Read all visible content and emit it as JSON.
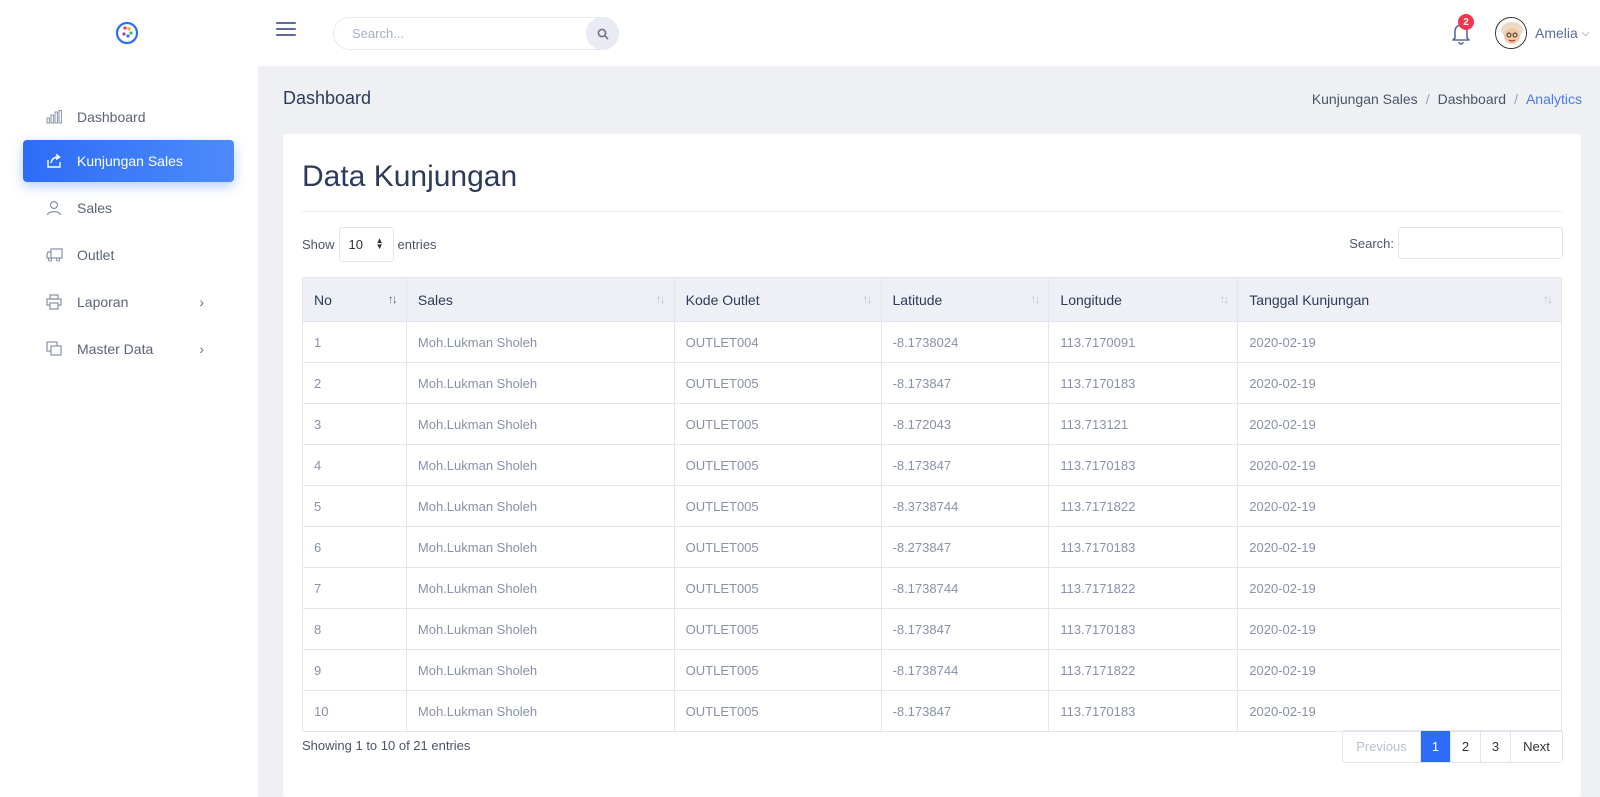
{
  "topbar": {
    "search_placeholder": "Search...",
    "notification_count": "2",
    "user_name": "Amelia"
  },
  "sidebar": {
    "items": [
      {
        "label": "Dashboard",
        "icon": "bar-chart-icon",
        "active": false,
        "has_submenu": false
      },
      {
        "label": "Kunjungan Sales",
        "icon": "share-icon",
        "active": true,
        "has_submenu": false
      },
      {
        "label": "Sales",
        "icon": "user-icon",
        "active": false,
        "has_submenu": false
      },
      {
        "label": "Outlet",
        "icon": "truck-icon",
        "active": false,
        "has_submenu": false
      },
      {
        "label": "Laporan",
        "icon": "printer-icon",
        "active": false,
        "has_submenu": true
      },
      {
        "label": "Master Data",
        "icon": "copy-icon",
        "active": false,
        "has_submenu": true
      }
    ]
  },
  "header": {
    "title": "Dashboard",
    "breadcrumb": [
      "Kunjungan Sales",
      "Dashboard",
      "Analytics"
    ]
  },
  "card": {
    "title": "Data Kunjungan",
    "show_label": "Show",
    "page_length": "10",
    "entries_label": "entries",
    "search_label": "Search:",
    "columns": [
      "No",
      "Sales",
      "Kode Outlet",
      "Latitude",
      "Longitude",
      "Tanggal Kunjungan"
    ],
    "rows": [
      [
        "1",
        "Moh.Lukman Sholeh",
        "OUTLET004",
        "-8.1738024",
        "113.7170091",
        "2020-02-19"
      ],
      [
        "2",
        "Moh.Lukman Sholeh",
        "OUTLET005",
        "-8.173847",
        "113.7170183",
        "2020-02-19"
      ],
      [
        "3",
        "Moh.Lukman Sholeh",
        "OUTLET005",
        "-8.172043",
        "113.713121",
        "2020-02-19"
      ],
      [
        "4",
        "Moh.Lukman Sholeh",
        "OUTLET005",
        "-8.173847",
        "113.7170183",
        "2020-02-19"
      ],
      [
        "5",
        "Moh.Lukman Sholeh",
        "OUTLET005",
        "-8.3738744",
        "113.7171822",
        "2020-02-19"
      ],
      [
        "6",
        "Moh.Lukman Sholeh",
        "OUTLET005",
        "-8.273847",
        "113.7170183",
        "2020-02-19"
      ],
      [
        "7",
        "Moh.Lukman Sholeh",
        "OUTLET005",
        "-8.1738744",
        "113.7171822",
        "2020-02-19"
      ],
      [
        "8",
        "Moh.Lukman Sholeh",
        "OUTLET005",
        "-8.173847",
        "113.7170183",
        "2020-02-19"
      ],
      [
        "9",
        "Moh.Lukman Sholeh",
        "OUTLET005",
        "-8.1738744",
        "113.7171822",
        "2020-02-19"
      ],
      [
        "10",
        "Moh.Lukman Sholeh",
        "OUTLET005",
        "-8.173847",
        "113.7170183",
        "2020-02-19"
      ]
    ],
    "info": "Showing 1 to 10 of 21 entries",
    "pagination": {
      "previous": "Previous",
      "pages": [
        "1",
        "2",
        "3"
      ],
      "current": "1",
      "next": "Next"
    }
  },
  "colors": {
    "accent": "#2d6cf6",
    "badge": "#f5364e",
    "breadcrumb_active": "#4a79f0"
  }
}
